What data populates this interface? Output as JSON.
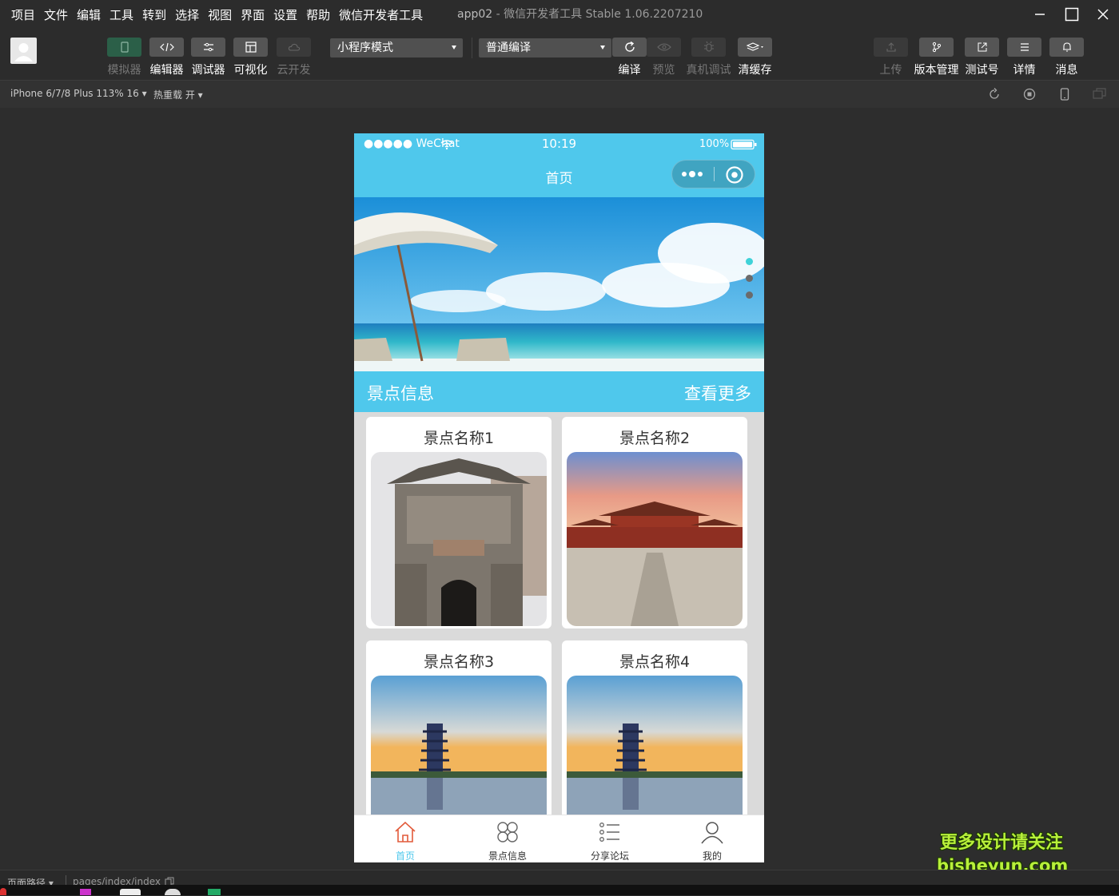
{
  "menu": [
    "项目",
    "文件",
    "编辑",
    "工具",
    "转到",
    "选择",
    "视图",
    "界面",
    "设置",
    "帮助",
    "微信开发者工具"
  ],
  "window_title": {
    "app": "app02",
    "sep": " - ",
    "rest": "微信开发者工具 Stable 1.06.2207210"
  },
  "toolbar": {
    "left_buttons": [
      {
        "label": "模拟器",
        "icon": "phone-icon",
        "active": false,
        "style": "green"
      },
      {
        "label": "编辑器",
        "icon": "code-icon",
        "active": true,
        "style": "dark"
      },
      {
        "label": "调试器",
        "icon": "debug-icon",
        "active": true,
        "style": "dark"
      },
      {
        "label": "可视化",
        "icon": "layout-icon",
        "active": true,
        "style": "dark"
      },
      {
        "label": "云开发",
        "icon": "cloud-icon",
        "active": false,
        "style": "off"
      }
    ],
    "mode_select": "小程序模式",
    "compile_select": "普通编译",
    "mid_buttons": [
      {
        "label": "编译",
        "icon": "refresh-icon",
        "active": true
      },
      {
        "label": "预览",
        "icon": "eye-icon",
        "active": false
      },
      {
        "label": "真机调试",
        "icon": "bug-icon",
        "active": false
      },
      {
        "label": "清缓存",
        "icon": "layers-icon",
        "active": true
      }
    ],
    "right_buttons": [
      {
        "label": "上传",
        "icon": "upload-icon",
        "active": false
      },
      {
        "label": "版本管理",
        "icon": "branch-icon",
        "active": true
      },
      {
        "label": "测试号",
        "icon": "external-link-icon",
        "active": true
      },
      {
        "label": "详情",
        "icon": "menu-icon",
        "active": true
      },
      {
        "label": "消息",
        "icon": "bell-icon",
        "active": true
      }
    ]
  },
  "subbar": {
    "device": "iPhone 6/7/8 Plus 113% 16 ▾",
    "hotreload": "热重载 开 ▾"
  },
  "phone": {
    "status": {
      "carrier": "●●●●● WeChat",
      "time": "10:19",
      "battery": "100%"
    },
    "nav_title": "首页",
    "section": {
      "title": "景点信息",
      "more": "查看更多"
    },
    "cards": [
      {
        "name": "景点名称1"
      },
      {
        "name": "景点名称2"
      },
      {
        "name": "景点名称3"
      },
      {
        "name": "景点名称4"
      }
    ],
    "tabs": [
      {
        "label": "首页",
        "active": true
      },
      {
        "label": "景点信息",
        "active": false
      },
      {
        "label": "分享论坛",
        "active": false
      },
      {
        "label": "我的",
        "active": false
      }
    ]
  },
  "bottom": {
    "path_label": "页面路径 ▾",
    "path": "pages/index/index"
  },
  "watermark": {
    "line1": "更多设计请关注",
    "line2": "bisheyun.com"
  },
  "colors": {
    "accent": "#4fc8ec",
    "tab_active": "#e25a3a"
  }
}
